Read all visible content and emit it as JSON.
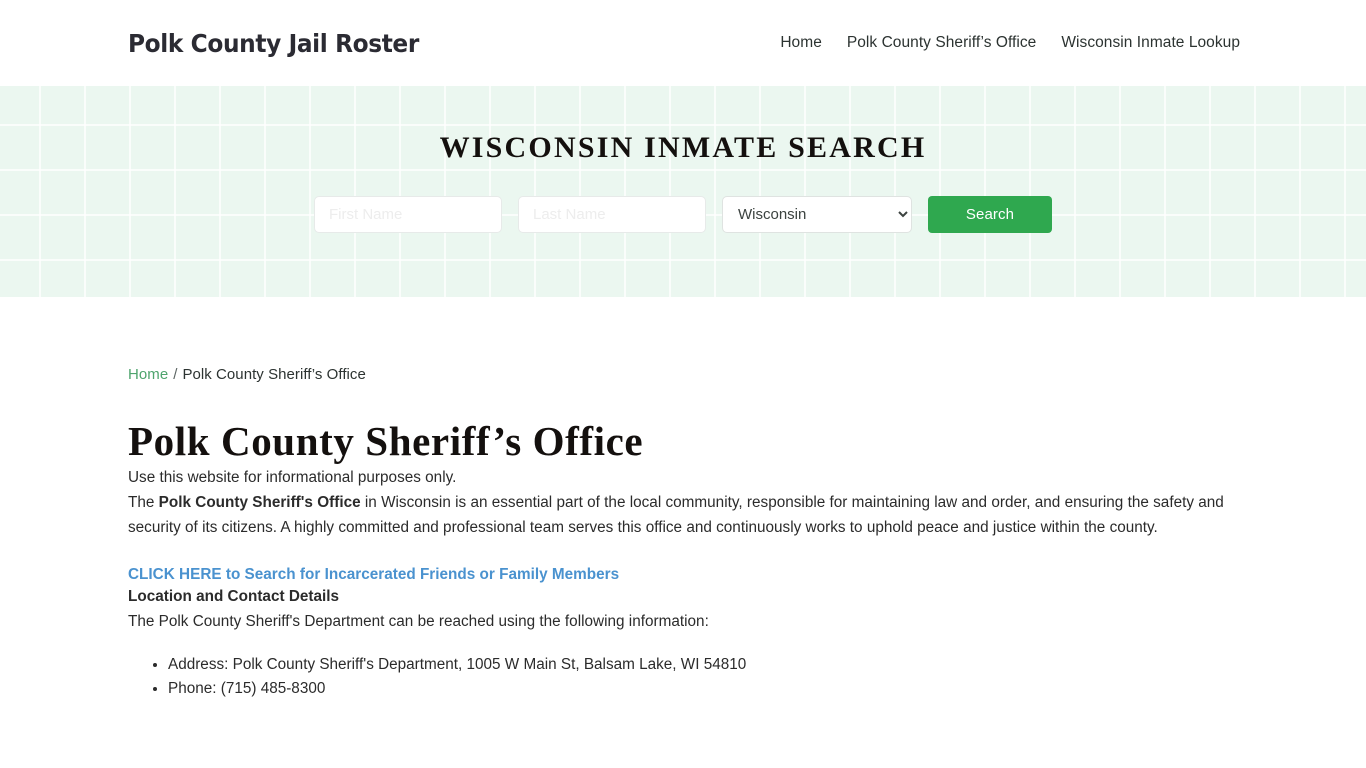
{
  "header": {
    "brand": "Polk County Jail Roster",
    "nav": [
      {
        "label": "Home"
      },
      {
        "label": "Polk County Sheriff’s Office"
      },
      {
        "label": "Wisconsin Inmate Lookup"
      }
    ]
  },
  "hero": {
    "title": "WISCONSIN INMATE SEARCH",
    "first_name_placeholder": "First Name",
    "first_name_value": "",
    "last_name_placeholder": "Last Name",
    "last_name_value": "",
    "state_selected": "Wisconsin",
    "state_options": [
      "Wisconsin"
    ],
    "search_label": "Search",
    "accent_color": "#2fa84f",
    "background_color": "#ebf7f0"
  },
  "breadcrumb": {
    "home": "Home",
    "separator": "/",
    "current": "Polk County Sheriff’s Office"
  },
  "main": {
    "page_title": "Polk County Sheriff’s Office",
    "paragraph_1": "Use this website for informational purposes only.",
    "paragraph_2_before": "The ",
    "paragraph_2_bold": "Polk County Sheriff's Office",
    "paragraph_2_after": " in Wisconsin is an essential part of the local community, responsible for maintaining law and order, and ensuring the safety and security of its citizens. A highly committed and professional team serves this office and continuously works to uphold peace and justice within the county.",
    "cta_link": "CLICK HERE to Search for Incarcerated Friends or Family Members",
    "cta_color": "#4a92cf",
    "sub_heading": "Location and Contact Details",
    "paragraph_3": "The Polk County Sheriff's Department can be reached using the following information:",
    "contact_items": [
      "Address: Polk County Sheriff's Department, 1005 W Main St, Balsam Lake, WI 54810",
      "Phone: (715) 485-8300"
    ]
  }
}
